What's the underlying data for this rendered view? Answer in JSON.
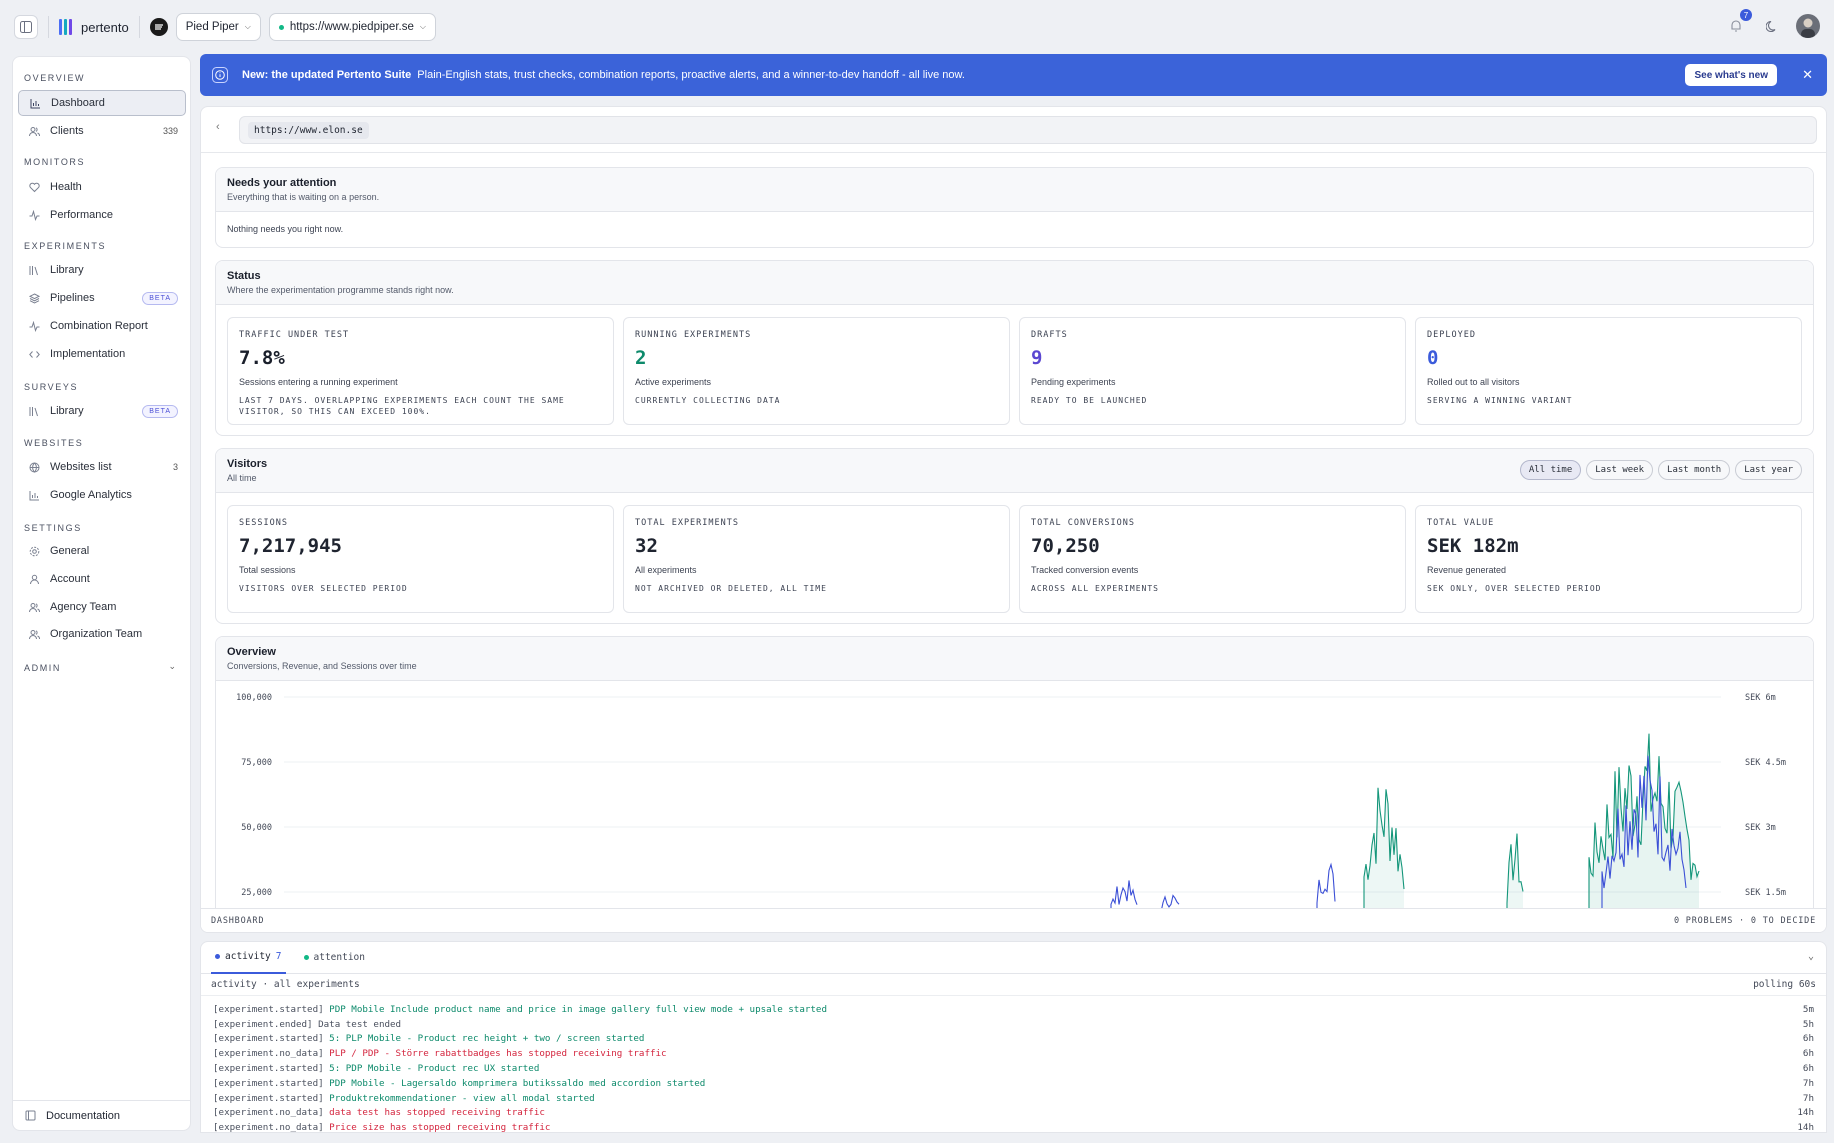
{
  "topbar": {
    "brand": "pertento",
    "org": "Pied Piper",
    "site": "https://www.piedpiper.se",
    "notifications": "7",
    "logo_colors": [
      "#4c6ef5",
      "#15aabf",
      "#7048e8"
    ]
  },
  "sidebar": {
    "sections": {
      "overview": "OVERVIEW",
      "monitors": "MONITORS",
      "experiments": "EXPERIMENTS",
      "surveys": "SURVEYS",
      "websites": "WEBSITES",
      "settings": "SETTINGS",
      "admin": "ADMIN"
    },
    "items": {
      "dashboard": "Dashboard",
      "clients": "Clients",
      "clients_count": "339",
      "health": "Health",
      "performance": "Performance",
      "exp_library": "Library",
      "pipelines": "Pipelines",
      "combination_report": "Combination Report",
      "implementation": "Implementation",
      "survey_library": "Library",
      "websites_list": "Websites list",
      "websites_count": "3",
      "google_analytics": "Google Analytics",
      "general": "General",
      "account": "Account",
      "agency_team": "Agency Team",
      "organization_team": "Organization Team"
    },
    "beta": "BETA",
    "documentation": "Documentation"
  },
  "banner": {
    "title": "New: the updated Pertento Suite",
    "text": "Plain-English stats, trust checks, combination reports, proactive alerts, and a winner-to-dev handoff - all live now.",
    "button": "See what's new"
  },
  "urlbar": {
    "url": "https://www.elon.se"
  },
  "attention": {
    "title": "Needs your attention",
    "subtitle": "Everything that is waiting on a person.",
    "empty": "Nothing needs you right now."
  },
  "status": {
    "title": "Status",
    "subtitle": "Where the experimentation programme stands right now.",
    "cards": [
      {
        "label": "TRAFFIC UNDER TEST",
        "value": "7.8%",
        "desc": "Sessions entering a running experiment",
        "note": "LAST 7 DAYS. OVERLAPPING EXPERIMENTS EACH COUNT THE SAME VISITOR, SO THIS CAN EXCEED 100%.",
        "color": "#1a1f2b"
      },
      {
        "label": "RUNNING EXPERIMENTS",
        "value": "2",
        "desc": "Active experiments",
        "note": "CURRENTLY COLLECTING DATA",
        "color": "#0d8a6b"
      },
      {
        "label": "DRAFTS",
        "value": "9",
        "desc": "Pending experiments",
        "note": "READY TO BE LAUNCHED",
        "color": "#5b47d1"
      },
      {
        "label": "DEPLOYED",
        "value": "0",
        "desc": "Rolled out to all visitors",
        "note": "SERVING A WINNING VARIANT",
        "color": "#3b5bdb"
      }
    ]
  },
  "visitors": {
    "title": "Visitors",
    "subtitle": "All time",
    "ranges": [
      "All time",
      "Last week",
      "Last month",
      "Last year"
    ],
    "cards": [
      {
        "label": "SESSIONS",
        "value": "7,217,945",
        "desc": "Total sessions",
        "note": "VISITORS OVER SELECTED PERIOD"
      },
      {
        "label": "TOTAL EXPERIMENTS",
        "value": "32",
        "desc": "All experiments",
        "note": "NOT ARCHIVED OR DELETED, ALL TIME"
      },
      {
        "label": "TOTAL CONVERSIONS",
        "value": "70,250",
        "desc": "Tracked conversion events",
        "note": "ACROSS ALL EXPERIMENTS"
      },
      {
        "label": "TOTAL VALUE",
        "value": "SEK 182m",
        "desc": "Revenue generated",
        "note": "SEK ONLY, OVER SELECTED PERIOD"
      }
    ]
  },
  "overview": {
    "title": "Overview",
    "subtitle": "Conversions, Revenue, and Sessions over time"
  },
  "chart_data": {
    "type": "area",
    "title": "",
    "xlabel": "",
    "ylabel": "",
    "y_left_ticks": [
      "100,000",
      "75,000",
      "50,000",
      "25,000"
    ],
    "y_right_ticks": [
      "SEK 6m",
      "SEK 4.5m",
      "SEK 3m",
      "SEK 1.5m"
    ],
    "ylim_left": [
      0,
      100000
    ],
    "ylim_right": [
      0,
      6000000
    ],
    "grid": true,
    "series": [],
    "colors": {
      "teal": "#14967a",
      "blue": "#3b4fd6"
    }
  },
  "footer": {
    "left": "DASHBOARD",
    "right": "0 PROBLEMS · 0 TO DECIDE"
  },
  "activity": {
    "tab_activity": "activity",
    "tab_activity_count": "7",
    "tab_attention": "attention",
    "scope": "activity · all experiments",
    "polling": "polling 60s",
    "log": [
      {
        "type": "[experiment.started]",
        "msg": "PDP Mobile Include product name and price in image gallery full view mode + upsale started",
        "kind": "ok",
        "time": "5m"
      },
      {
        "type": "[experiment.ended]",
        "msg": "Data test ended",
        "kind": "neutral",
        "time": "5h"
      },
      {
        "type": "[experiment.started]",
        "msg": "5: PLP Mobile - Product rec height + two / screen started",
        "kind": "ok",
        "time": "6h"
      },
      {
        "type": "[experiment.no_data]",
        "msg": "PLP / PDP - Större rabattbadges has stopped receiving traffic",
        "kind": "err",
        "time": "6h"
      },
      {
        "type": "[experiment.started]",
        "msg": "5: PDP Mobile - Product rec UX started",
        "kind": "ok",
        "time": "6h"
      },
      {
        "type": "[experiment.started]",
        "msg": "PDP Mobile - Lagersaldo komprimera butikssaldo med accordion started",
        "kind": "ok",
        "time": "7h"
      },
      {
        "type": "[experiment.started]",
        "msg": "Produktrekommendationer - view all modal started",
        "kind": "ok",
        "time": "7h"
      },
      {
        "type": "[experiment.no_data]",
        "msg": "data test has stopped receiving traffic",
        "kind": "err",
        "time": "14h"
      },
      {
        "type": "[experiment.no_data]",
        "msg": "Price size has stopped receiving traffic",
        "kind": "err",
        "time": "14h"
      }
    ]
  }
}
